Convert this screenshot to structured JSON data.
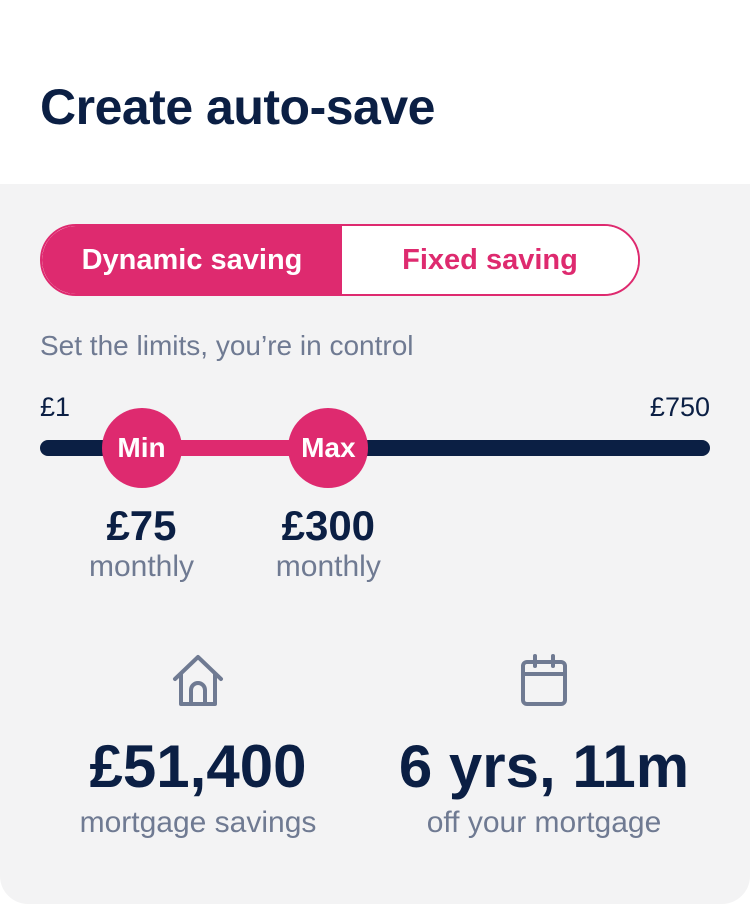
{
  "header": {
    "title": "Create auto-save"
  },
  "mode_toggle": {
    "options": [
      "Dynamic saving",
      "Fixed saving"
    ],
    "selected": "Dynamic saving"
  },
  "limits": {
    "subtitle": "Set the limits, you’re in control",
    "range_min_label": "£1",
    "range_max_label": "£750",
    "range_min": 1,
    "range_max": 750,
    "min_thumb_label": "Min",
    "max_thumb_label": "Max",
    "min_value": "£75",
    "max_value": "£300",
    "min_amount": 75,
    "max_amount": 300,
    "period": "monthly"
  },
  "stats": [
    {
      "icon": "house-icon",
      "value": "£51,400",
      "label": "mortgage savings"
    },
    {
      "icon": "calendar-icon",
      "value": "6 yrs, 11m",
      "label": "off your mortgage"
    }
  ],
  "colors": {
    "brand_pink": "#de2a6f",
    "navy": "#0b1f44",
    "muted": "#6f7a92",
    "panel": "#f3f3f4"
  }
}
